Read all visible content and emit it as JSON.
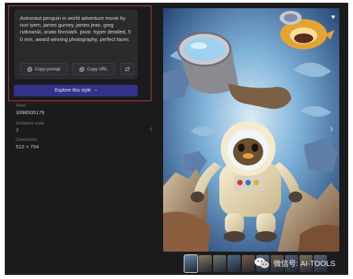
{
  "prompt": {
    "text": "Astronaut penguin in world adventure movie by nuri iyem, james gurney, james jean, greg rutkowski, anato finnstark. pixar. hyper detailed, 5 0 mm, award winning photography, perfect faces",
    "copy_prompt_label": "Copy prompt",
    "copy_url_label": "Copy URL"
  },
  "explore": {
    "label": "Explore this style",
    "arrow": "›"
  },
  "details": {
    "seed_label": "Seed",
    "seed_value": "3398505179",
    "guidance_label": "Guidance scale",
    "guidance_value": "7",
    "dimensions_label": "Dimensions",
    "dimensions_value": "512 × 704"
  },
  "nav": {
    "prev": "‹",
    "next": "›"
  },
  "thumbnails": [
    {
      "color": "#6b86a8",
      "active": true
    },
    {
      "color": "#8a7a62"
    },
    {
      "color": "#6d7b6a"
    },
    {
      "color": "#4f6b89"
    },
    {
      "color": "#7b5e4a"
    },
    {
      "color": "#5e6f8c"
    },
    {
      "color": "#6b5a4d"
    },
    {
      "color": "#4b5f77"
    },
    {
      "color": "#7d6e5c"
    },
    {
      "color": "#5a667a"
    }
  ],
  "watermark": {
    "text": "微信号: AI-TOOLS"
  },
  "colors": {
    "accent": "#32328a",
    "highlight": "#b9423e",
    "background": "#1b1b1d"
  }
}
